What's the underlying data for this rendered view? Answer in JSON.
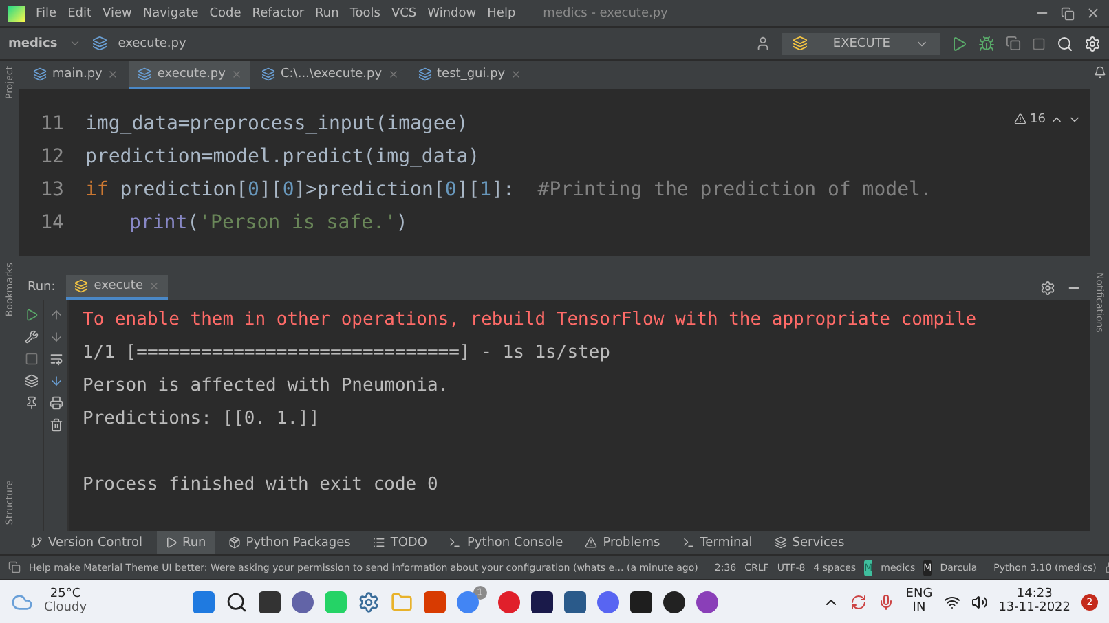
{
  "menu_bar": {
    "items": [
      "File",
      "Edit",
      "View",
      "Navigate",
      "Code",
      "Refactor",
      "Run",
      "Tools",
      "VCS",
      "Window",
      "Help"
    ],
    "title": "medics - execute.py"
  },
  "nav_bar": {
    "project": "medics",
    "file": "execute.py",
    "run_config": "EXECUTE"
  },
  "tabs": [
    {
      "label": "main.py",
      "selected": false
    },
    {
      "label": "execute.py",
      "selected": true
    },
    {
      "label": "C:\\...\\execute.py",
      "selected": false
    },
    {
      "label": "test_gui.py",
      "selected": false
    }
  ],
  "side_tools": {
    "left_top": "Project",
    "left_mid": "Bookmarks",
    "left_bottom": "Structure",
    "right": "Notifications"
  },
  "editor": {
    "warnings": "16",
    "lines": [
      {
        "number": "11",
        "segments": [
          {
            "kind": "plain",
            "text": "img_data=preprocess_input(imagee)"
          }
        ]
      },
      {
        "number": "12",
        "segments": [
          {
            "kind": "plain",
            "text": "prediction=model.predict(img_data)"
          }
        ]
      },
      {
        "number": "13",
        "segments": [
          {
            "kind": "keyword",
            "text": "if "
          },
          {
            "kind": "plain",
            "text": "prediction["
          },
          {
            "kind": "number",
            "text": "0"
          },
          {
            "kind": "plain",
            "text": "]["
          },
          {
            "kind": "number",
            "text": "0"
          },
          {
            "kind": "plain",
            "text": "]>prediction["
          },
          {
            "kind": "number",
            "text": "0"
          },
          {
            "kind": "plain",
            "text": "]["
          },
          {
            "kind": "number",
            "text": "1"
          },
          {
            "kind": "plain",
            "text": "]:  "
          },
          {
            "kind": "comment",
            "text": "#Printing the prediction of model."
          }
        ]
      },
      {
        "number": "14",
        "indented": true,
        "segments": [
          {
            "kind": "builtin",
            "text": "print"
          },
          {
            "kind": "plain",
            "text": "("
          },
          {
            "kind": "string",
            "text": "'Person is safe.'"
          },
          {
            "kind": "plain",
            "text": ")"
          }
        ]
      }
    ]
  },
  "run_panel": {
    "label": "Run:",
    "tab": "execute",
    "output": [
      {
        "kind": "error",
        "text": "To enable them in other operations, rebuild TensorFlow with the appropriate compile"
      },
      {
        "kind": "normal",
        "text": "1/1 [==============================] - 1s 1s/step"
      },
      {
        "kind": "normal",
        "text": "Person is affected with Pneumonia."
      },
      {
        "kind": "normal",
        "text": "Predictions: [[0. 1.]]"
      },
      {
        "kind": "blank"
      },
      {
        "kind": "normal",
        "text": "Process finished with exit code 0"
      }
    ]
  },
  "tool_tabs": [
    {
      "label": "Version Control",
      "selected": false
    },
    {
      "label": "Run",
      "selected": true
    },
    {
      "label": "Python Packages",
      "selected": false
    },
    {
      "label": "TODO",
      "selected": false
    },
    {
      "label": "Python Console",
      "selected": false
    },
    {
      "label": "Problems",
      "selected": false
    },
    {
      "label": "Terminal",
      "selected": false
    },
    {
      "label": "Services",
      "selected": false
    }
  ],
  "status_bar": {
    "message": "Help make Material Theme UI better: Were asking your permission to send information about your configuration (whats e... (a minute ago)",
    "items": [
      "2:36",
      "CRLF",
      "UTF-8",
      "4 spaces"
    ],
    "project_badge": "M",
    "project": "medics",
    "theme_badge": "M",
    "theme": "Darcula",
    "interpreter": "Python 3.10 (medics)"
  },
  "taskbar": {
    "temperature": "25°C",
    "weather": "Cloudy",
    "chrome_badge": "1",
    "language": "ENG",
    "region": "IN",
    "time": "14:23",
    "date": "13-11-2022",
    "notifications": "2"
  }
}
